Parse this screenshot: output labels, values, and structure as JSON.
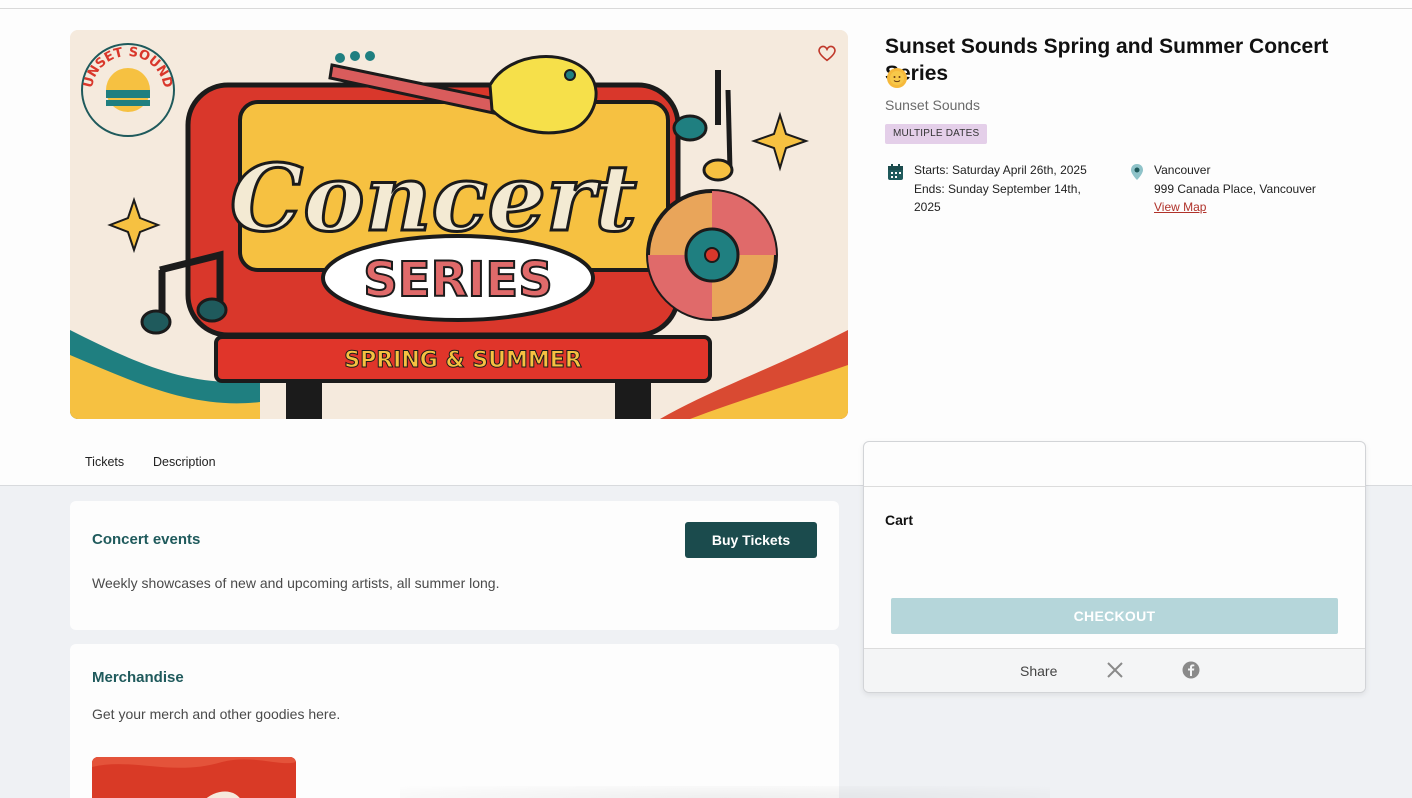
{
  "event": {
    "title": "Sunset Sounds Spring and Summer Concert Series",
    "emoji_icon": "sun-emoji-icon",
    "organizer": "Sunset Sounds",
    "badge": "MULTIPLE DATES",
    "dates": {
      "starts": "Starts: Saturday April 26th, 2025",
      "ends": "Ends: Sunday September 14th, 2025"
    },
    "location": {
      "city": "Vancouver",
      "address": "999 Canada Place, Vancouver",
      "map_link": "View Map"
    }
  },
  "banner": {
    "logo_text": "SUNSET SOUNDS",
    "headline": "Concert",
    "subhead": "SERIES",
    "strip": "SPRING & SUMMER"
  },
  "tabs": [
    {
      "label": "Tickets"
    },
    {
      "label": "Description"
    }
  ],
  "sections": [
    {
      "title": "Concert events",
      "description": "Weekly showcases of new and upcoming artists, all summer long.",
      "button": "Buy Tickets"
    },
    {
      "title": "Merchandise",
      "description": "Get your merch and other goodies here."
    }
  ],
  "cart": {
    "label": "Cart",
    "checkout": "CHECKOUT",
    "share_label": "Share"
  },
  "colors": {
    "brand_dark_teal": "#1b4b4d",
    "section_title": "#1f5a5c",
    "checkout_disabled": "#b5d6da",
    "badge_bg": "#e4cfe9",
    "link_red": "#b0322a"
  }
}
